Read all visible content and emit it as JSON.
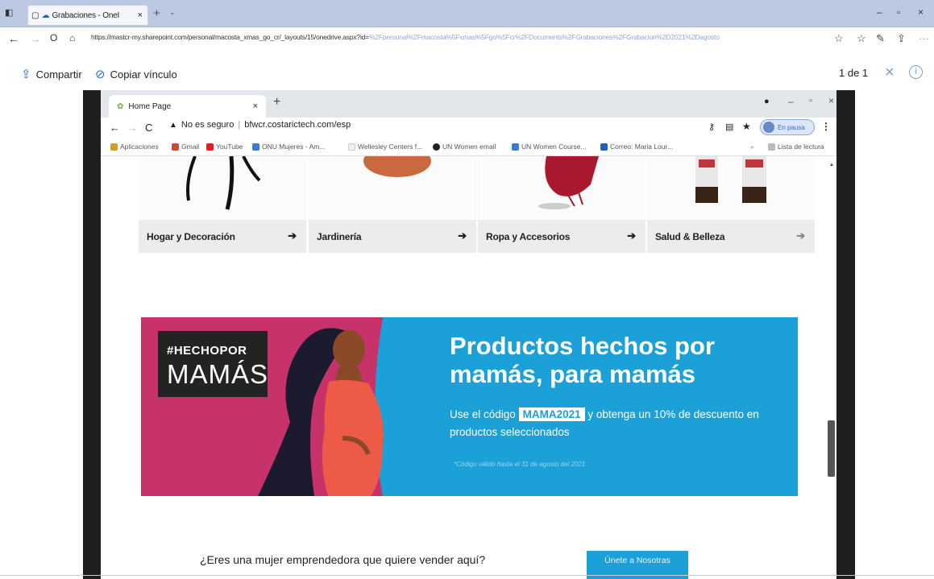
{
  "outer_browser": {
    "tab_title": "Grabaciones - OneI",
    "url": "https://mastcr-my.sharepoint.com/personal/macosta_xmas_go_cr/_layouts/15/onedrive.aspx?id=",
    "url_tail": "%2Fpersonal%2Fmacosta%5Fxmas%5Fgo%5Fcr%2FDocuments%2FGrabaciones%2FGrabacion%2D2021%2Dagosto"
  },
  "onedrive_toolbar": {
    "share_label": "Compartir",
    "copy_link_label": "Copiar vínculo",
    "page_counter": "1 de 1"
  },
  "inner_browser": {
    "tab_title": "Home Page",
    "url_warning": "No es seguro",
    "url": "bfwcr.costarictech.com/esp",
    "profile_label": "En pausa",
    "bookmarks": [
      {
        "label": "Aplicaciones",
        "color": "#d0a020"
      },
      {
        "label": "Gmail",
        "color": "#d44638"
      },
      {
        "label": "YouTube",
        "color": "#e02020"
      },
      {
        "label": "ONU Mujeres - Am...",
        "color": "#3b7bd4"
      },
      {
        "label": "Wellesley Centers f...",
        "color": "#f0f0f0"
      },
      {
        "label": "UN Women email",
        "color": "#222222"
      },
      {
        "label": "UN Women Course...",
        "color": "#3b7bd4"
      },
      {
        "label": "Correo: Maria Lour...",
        "color": "#2060c0"
      }
    ],
    "reading_list": "Lista de lectura"
  },
  "categories": [
    {
      "label": "Hogar y Decoración"
    },
    {
      "label": "Jardinería"
    },
    {
      "label": "Ropa y Accesorios"
    },
    {
      "label": "Salud & Belleza"
    }
  ],
  "banner": {
    "hashtag_line1": "#HECHOPOR",
    "hashtag_line2": "MAMÁS",
    "title": "Productos hechos por mamás, para mamás",
    "desc_prefix": "Use el código",
    "code": "MAMA2021",
    "desc_suffix": "y obtenga un 10% de descuento en productos seleccionados",
    "fine_print": "*Código válido hasta el 31 de agosto del 2021",
    "colors": {
      "accent": "#1ba0d7",
      "left_panel": "#c8326b"
    }
  },
  "cta": {
    "question": "¿Eres una mujer emprendedora que quiere vender aquí?",
    "button": "Únete a Nosotras"
  }
}
